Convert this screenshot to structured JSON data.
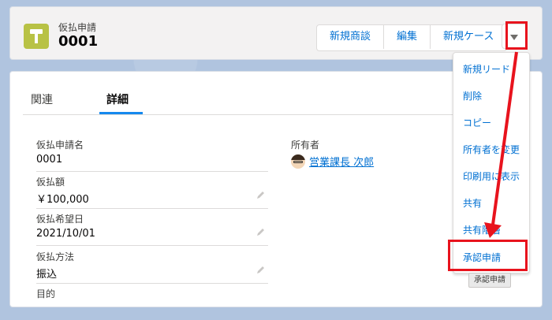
{
  "header": {
    "object_label": "仮払申請",
    "record_name": "0001",
    "icon": "hammer-icon",
    "buttons": [
      "新規商談",
      "編集",
      "新規ケース"
    ],
    "more_icon": "chevron-down-icon"
  },
  "tabs": [
    {
      "label": "関連"
    },
    {
      "label": "詳細"
    }
  ],
  "fields": [
    {
      "label": "仮払申請名",
      "value": "0001"
    },
    {
      "label": "仮払額",
      "value": "￥100,000"
    },
    {
      "label": "仮払希望日",
      "value": "2021/10/01"
    },
    {
      "label": "仮払方法",
      "value": "振込"
    },
    {
      "label": "目的",
      "value": ""
    }
  ],
  "owner": {
    "label": "所有者",
    "name": "営業課長 次郎"
  },
  "menu": {
    "items": [
      "新規リード",
      "削除",
      "コピー",
      "所有者を変更",
      "印刷用に表示",
      "共有",
      "共有階層",
      "承認申請"
    ]
  },
  "tooltip": "承認申請",
  "colors": {
    "accent": "#0070d2",
    "highlight": "#e8131d",
    "object_icon": "#b8c245",
    "tab_underline": "#1589ee"
  }
}
